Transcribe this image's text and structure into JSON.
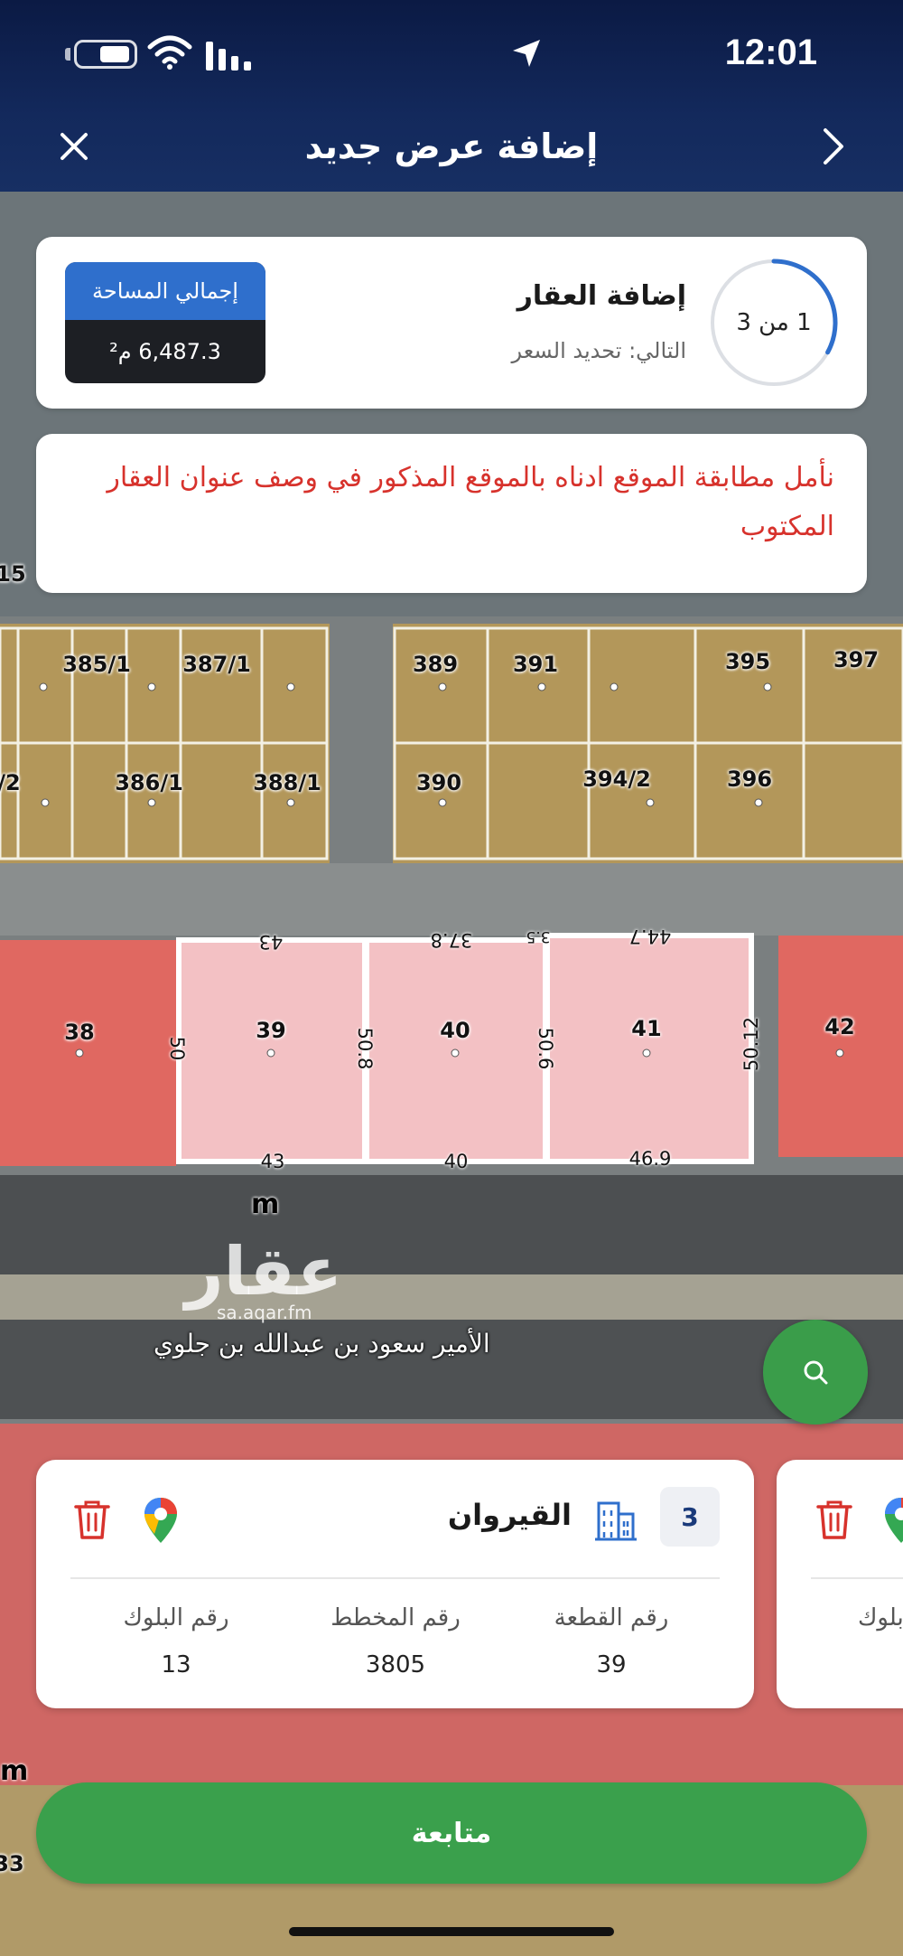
{
  "status_bar": {
    "time": "12:01"
  },
  "header": {
    "title": "إضافة عرض جديد"
  },
  "progress": {
    "step_text": "1 من 3",
    "fraction": 0.33,
    "title": "إضافة العقار",
    "next": "التالي: تحديد السعر"
  },
  "area": {
    "label": "إجمالي المساحة",
    "value": "6,487.3 م²"
  },
  "warning": {
    "text": "نأمل مطابقة الموقع ادناه بالموقع المذكور في وصف عنوان العقار المكتوب"
  },
  "map": {
    "parcels_top": [
      "385/1",
      "387/1",
      "389",
      "391",
      "395",
      "397",
      "/2",
      "386/1",
      "388/1",
      "390",
      "394/2",
      "396"
    ],
    "parcels_main": [
      "38",
      "39",
      "40",
      "41",
      "42"
    ],
    "dims_top": [
      "43",
      "37.8",
      "3.5",
      "44.7"
    ],
    "dims_bottom": [
      "43",
      "40",
      "46.9"
    ],
    "dims_side": [
      "50",
      "50.8",
      "50.6",
      "50.12"
    ],
    "side_labels": [
      "15",
      "33"
    ],
    "street": "الأمير سعود بن عبدالله بن جلوي",
    "m_label": "m",
    "watermark": "عقار",
    "watermark_sub": "sa.aqar.fm"
  },
  "property": {
    "count": "3",
    "name": "القيروان",
    "fields": [
      {
        "label": "رقم القطعة",
        "value": "39"
      },
      {
        "label": "رقم المخطط",
        "value": "3805"
      },
      {
        "label": "رقم البلوك",
        "value": "13"
      }
    ],
    "peek_label": "بلوك"
  },
  "continue_label": "متابعة",
  "colors": {
    "header": "#13295c",
    "accent_blue": "#2f6fcc",
    "green": "#3aa04c",
    "warning_red": "#d7322c",
    "parcel_selected": "#f3c1c4",
    "parcel_red": "#e8665e"
  }
}
